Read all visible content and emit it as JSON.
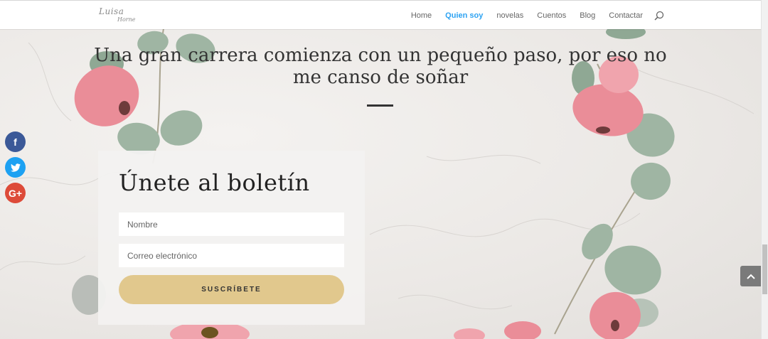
{
  "header": {
    "logo_main": "Luisa",
    "logo_sub": "Horne",
    "nav": [
      {
        "label": "Home",
        "active": false
      },
      {
        "label": "Quien soy",
        "active": true
      },
      {
        "label": "novelas",
        "active": false
      },
      {
        "label": "Cuentos",
        "active": false
      },
      {
        "label": "Blog",
        "active": false
      },
      {
        "label": "Contactar",
        "active": false
      }
    ],
    "search_icon": "search-icon"
  },
  "hero": {
    "title": "Una gran carrera comienza con un pequeño paso, por eso no me canso de soñar"
  },
  "social": {
    "facebook": "f",
    "twitter": "twitter-bird",
    "googleplus": "G+"
  },
  "newsletter": {
    "title": "Únete al boletín",
    "name_placeholder": "Nombre",
    "email_placeholder": "Correo electrónico",
    "button_label": "SUSCRÍBETE"
  },
  "colors": {
    "accent": "#2ea3f2",
    "button": "#e1c88d",
    "facebook": "#3b5998",
    "twitter": "#1da1f2",
    "googleplus": "#dd4b39"
  }
}
